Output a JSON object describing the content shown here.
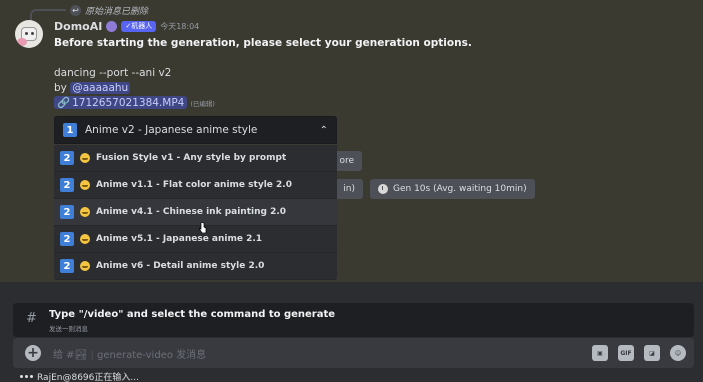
{
  "reply": {
    "text": "原始消息已删除"
  },
  "message": {
    "username": "DomoAI",
    "app_badge": "✓机器人",
    "timestamp": "今天18:04",
    "headline": "Before starting the generation, please select your generation options.",
    "prompt_line": "dancing --port --ani v2",
    "by_prefix": "by ",
    "by_mention": "@aaaaahu",
    "file_name": "1712657021384.MP4",
    "file_edited": "(已编辑)"
  },
  "select": {
    "number": "1",
    "selected": "Anime v2 - Japanese anime style",
    "options": [
      {
        "num": "2",
        "label": "Fusion Style v1 - Any style by prompt",
        "emoji": "smile-emoji"
      },
      {
        "num": "2",
        "label": "Anime v1.1 - Flat color anime style 2.0",
        "emoji": "smile-emoji"
      },
      {
        "num": "2",
        "label": "Anime v4.1 - Chinese ink painting 2.0",
        "emoji": "smile-emoji"
      },
      {
        "num": "2",
        "label": "Anime v5.1 - Japanese anime 2.1",
        "emoji": "smile-emoji"
      },
      {
        "num": "2",
        "label": "Anime v6 - Detail anime style 2.0",
        "emoji": "smile-emoji"
      }
    ]
  },
  "buttons": {
    "more_fragment": "ore",
    "gen_fragment": "in)",
    "gen10": "Gen 10s (Avg. waiting 10min)"
  },
  "command": {
    "title": "Type \"/video\" and select the command to generate",
    "subtitle": "发送一则消息"
  },
  "input": {
    "placeholder_prefix": "给 #",
    "placeholder_sep": " | ",
    "placeholder_channel": "generate-video 发消息"
  },
  "input_icons": [
    "gift-icon",
    "gif-icon",
    "sticker-icon",
    "emoji-icon"
  ],
  "typing": {
    "text": "RajEn@8696正在输入..."
  }
}
